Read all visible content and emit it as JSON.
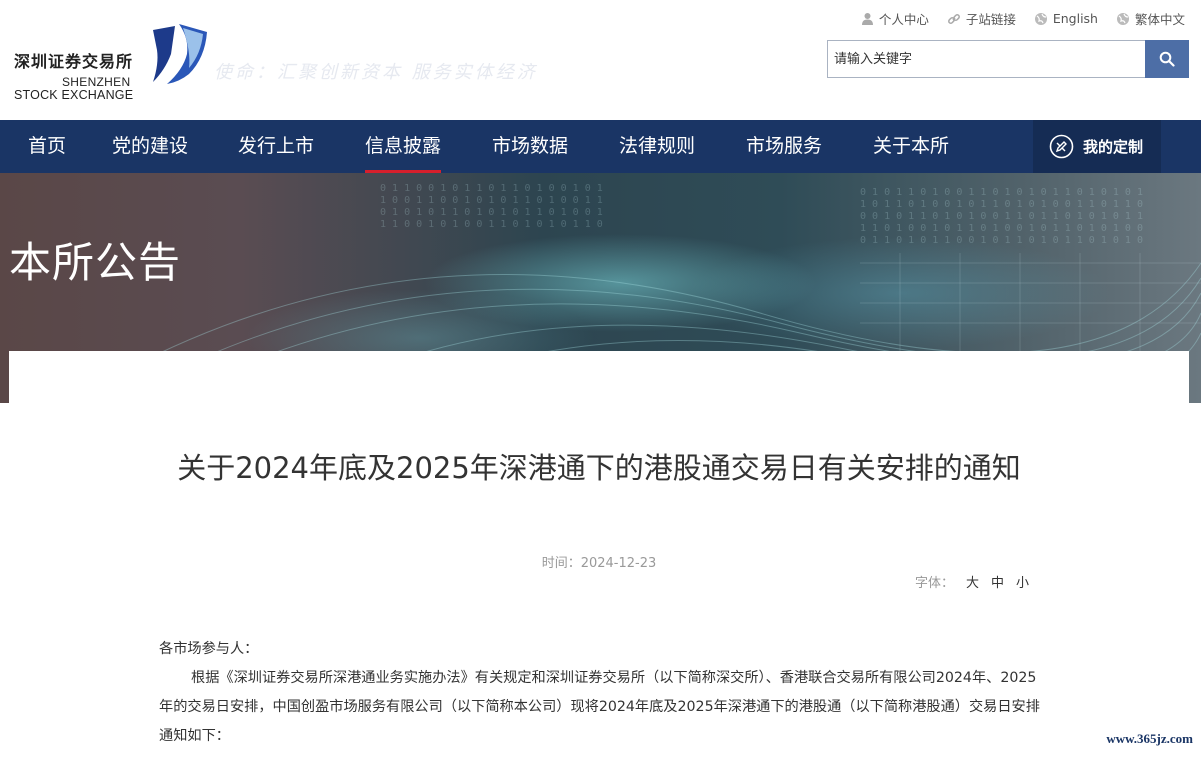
{
  "header": {
    "logo_cn": "深圳证券交易所",
    "logo_en_line1": "SHENZHEN",
    "logo_en_line2": "STOCK EXCHANGE",
    "slogan": "使命：汇聚创新资本 服务实体经济",
    "top_links": [
      {
        "label": "个人中心",
        "icon": "user-icon"
      },
      {
        "label": "子站链接",
        "icon": "link-icon"
      },
      {
        "label": "English",
        "icon": "globe-icon"
      },
      {
        "label": "繁体中文",
        "icon": "globe-icon"
      }
    ],
    "search": {
      "placeholder": "请输入关键字",
      "icon": "search-icon"
    }
  },
  "nav": {
    "items": [
      "首页",
      "党的建设",
      "发行上市",
      "信息披露",
      "市场数据",
      "法律规则",
      "市场服务",
      "关于本所"
    ],
    "active_index": 3,
    "custom_label": "我的定制",
    "colors": {
      "bar": "#1a3565",
      "active_underline": "#d61f2c"
    }
  },
  "banner": {
    "title": "本所公告"
  },
  "article": {
    "title": "关于2024年底及2025年深港通下的港股通交易日有关安排的通知",
    "date_label": "时间：",
    "date": "2024-12-23",
    "font_label": "字体：",
    "font_sizes": [
      "大",
      "中",
      "小"
    ],
    "salutation": "各市场参与人：",
    "paragraph1": "根据《深圳证券交易所深港通业务实施办法》有关规定和深圳证券交易所（以下简称深交所）、香港联合交易所有限公司2024年、2025年的交易日安排，中国创盈市场服务有限公司（以下简称本公司）现将2024年底及2025年深港通下的港股通（以下简称港股通）交易日安排通知如下："
  },
  "watermark": "www.365jz.com"
}
